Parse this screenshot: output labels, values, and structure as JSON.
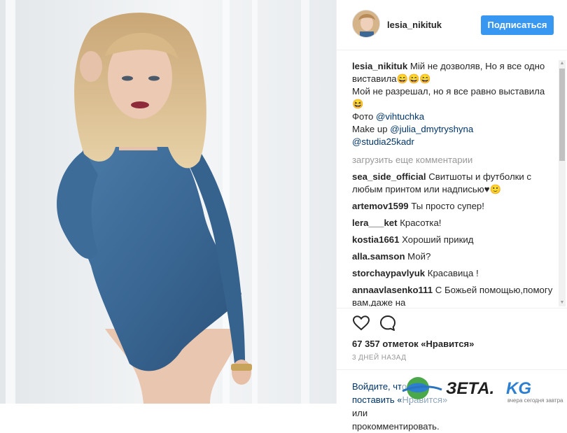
{
  "post": {
    "username": "lesia_nikituk",
    "follow_label": "Подписаться",
    "caption": {
      "user": "lesia_nikituk",
      "line1": "Мій не дозволяв, Но я все одно виставила😄😄😄",
      "line2": "Мой не разрешал, но я все равно выставила😆",
      "photo_prefix": "Фото ",
      "photo_link": "@vihtuchka",
      "makeup_prefix": "Make up ",
      "makeup_link": "@julia_dmytryshyna",
      "studio_link": "@studia25kadr"
    },
    "load_more": "загрузить еще комментарии",
    "comments": [
      {
        "user": "sea_side_official",
        "text": "Свитшоты и футболки с любым принтом или надписью♥🙂"
      },
      {
        "user": "artemov1599",
        "text": "Ты просто супер!"
      },
      {
        "user": "lera___ket",
        "text": "Красотка!"
      },
      {
        "user": "kostia1661",
        "text": "Хороший прикид"
      },
      {
        "user": "alla.samson",
        "text": "Мой?"
      },
      {
        "user": "storchaypavlyuk",
        "text": "Красавица !"
      },
      {
        "user": "annaavlasenko111",
        "text": "С Божьей помощью,помогу вам,даже на"
      }
    ],
    "likes": "67 357 отметок «Нравится»",
    "time_ago": "3 ДНЕЙ НАЗАД",
    "login": {
      "prefix": "Войдите, чтобы поставить «Нравится» ",
      "suffix": "или прокомментировать."
    },
    "watermark": {
      "brand": "ЗЕТА.KG",
      "tagline": "вчера сегодня завтра"
    }
  },
  "icons": [
    "heart-icon",
    "comment-bubble-icon"
  ],
  "colors": {
    "follow_button": "#3897f0",
    "link": "#003569",
    "muted": "#999999"
  }
}
